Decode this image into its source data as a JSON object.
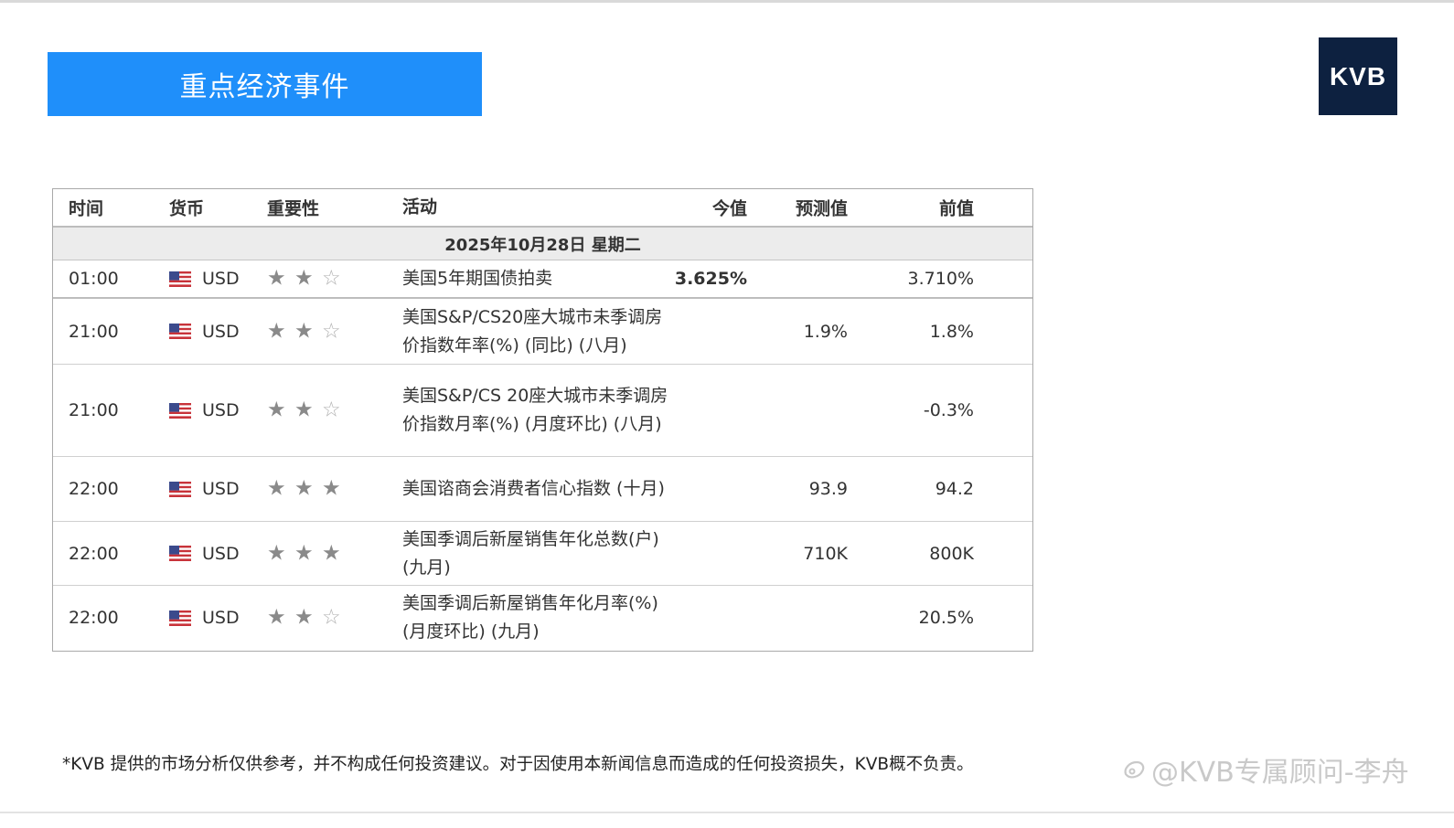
{
  "title": "重点经济事件",
  "logo": "KVB",
  "table": {
    "headers": {
      "time": "时间",
      "currency": "货币",
      "importance": "重要性",
      "event": "活动",
      "actual": "今值",
      "forecast": "预测值",
      "previous": "前值"
    },
    "date": "2025年10月28日  星期二",
    "rows": [
      {
        "time": "01:00",
        "currency": "USD",
        "importance": 2,
        "event": "美国5年期国债拍卖",
        "actual": "3.625%",
        "forecast": "",
        "previous": "3.710%"
      },
      {
        "time": "21:00",
        "currency": "USD",
        "importance": 2,
        "event": "美国S&P/CS20座大城市未季调房价指数年率(%) (同比) (八月)",
        "actual": "",
        "forecast": "1.9%",
        "previous": "1.8%"
      },
      {
        "time": "21:00",
        "currency": "USD",
        "importance": 2,
        "event": "美国S&P/CS 20座大城市未季调房价指数月率(%) (月度环比) (八月)",
        "actual": "",
        "forecast": "",
        "previous": "-0.3%"
      },
      {
        "time": "22:00",
        "currency": "USD",
        "importance": 3,
        "event": "美国谘商会消费者信心指数 (十月)",
        "actual": "",
        "forecast": "93.9",
        "previous": "94.2"
      },
      {
        "time": "22:00",
        "currency": "USD",
        "importance": 3,
        "event": "美国季调后新屋销售年化总数(户) (九月)",
        "actual": "",
        "forecast": "710K",
        "previous": "800K"
      },
      {
        "time": "22:00",
        "currency": "USD",
        "importance": 2,
        "event": "美国季调后新屋销售年化月率(%) (月度环比) (九月)",
        "actual": "",
        "forecast": "",
        "previous": "20.5%"
      }
    ]
  },
  "disclaimer": "*KVB 提供的市场分析仅供参考，并不构成任何投资建议。对于因使用本新闻信息而造成的任何投资损失，KVB概不负责。",
  "watermark": "@KVB专属顾问-李舟",
  "colors": {
    "banner": "#1f8ffa",
    "logo_bg": "#0d2140",
    "date_row_bg": "#ececec"
  }
}
